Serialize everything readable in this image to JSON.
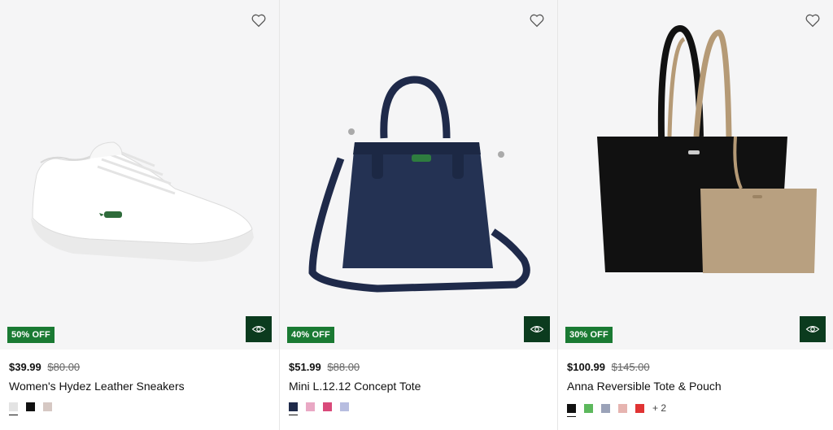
{
  "products": [
    {
      "badge": "50% OFF",
      "price": "$39.99",
      "old_price": "$80.00",
      "title": "Women's Hydez Leather Sneakers",
      "swatches": [
        "#e3e3e3",
        "#111111",
        "#d6c8c3"
      ],
      "more": ""
    },
    {
      "badge": "40% OFF",
      "price": "$51.99",
      "old_price": "$88.00",
      "title": "Mini L.12.12 Concept Tote",
      "swatches": [
        "#1f2a4a",
        "#e9a8c4",
        "#d94a7a",
        "#b7bde0"
      ],
      "more": ""
    },
    {
      "badge": "30% OFF",
      "price": "$100.99",
      "old_price": "$145.00",
      "title": "Anna Reversible Tote & Pouch",
      "swatches": [
        "#111111",
        "#5cb85c",
        "#9aa2b8",
        "#e6b4b0",
        "#e03333"
      ],
      "more": "+ 2"
    }
  ],
  "colors": {
    "badge_bg": "#1a7a33",
    "quick_view_bg": "#0b3b1e",
    "image_bg": "#f5f5f6"
  }
}
